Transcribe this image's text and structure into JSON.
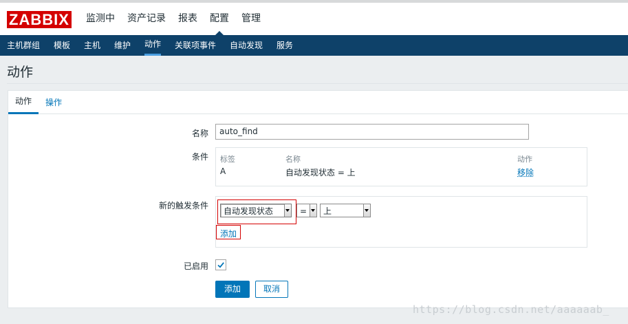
{
  "header": {
    "logo": "ZABBIX",
    "menu": [
      "监测中",
      "资产记录",
      "报表",
      "配置",
      "管理"
    ],
    "active_menu": "配置"
  },
  "subnav": {
    "items": [
      "主机群组",
      "模板",
      "主机",
      "维护",
      "动作",
      "关联项事件",
      "自动发现",
      "服务"
    ],
    "active": "动作"
  },
  "page_title": "动作",
  "tabs": [
    "动作",
    "操作"
  ],
  "form": {
    "name_label": "名称",
    "name_value": "auto_find",
    "conditions_label": "条件",
    "conditions_table": {
      "headers": [
        "标签",
        "名称",
        "动作"
      ],
      "rows": [
        {
          "label": "A",
          "name": "自动发现状态 = 上",
          "action": "移除"
        }
      ]
    },
    "new_condition_label": "新的触发条件",
    "new_condition": {
      "type": "自动发现状态",
      "operator": "=",
      "value": "上",
      "add": "添加"
    },
    "enabled_label": "已启用",
    "enabled": true,
    "buttons": {
      "add": "添加",
      "cancel": "取消"
    }
  },
  "watermark": "https://blog.csdn.net/aaaaaab_",
  "colors": {
    "brand": "#d40000",
    "nav": "#0e4169",
    "accent": "#0275b8"
  }
}
